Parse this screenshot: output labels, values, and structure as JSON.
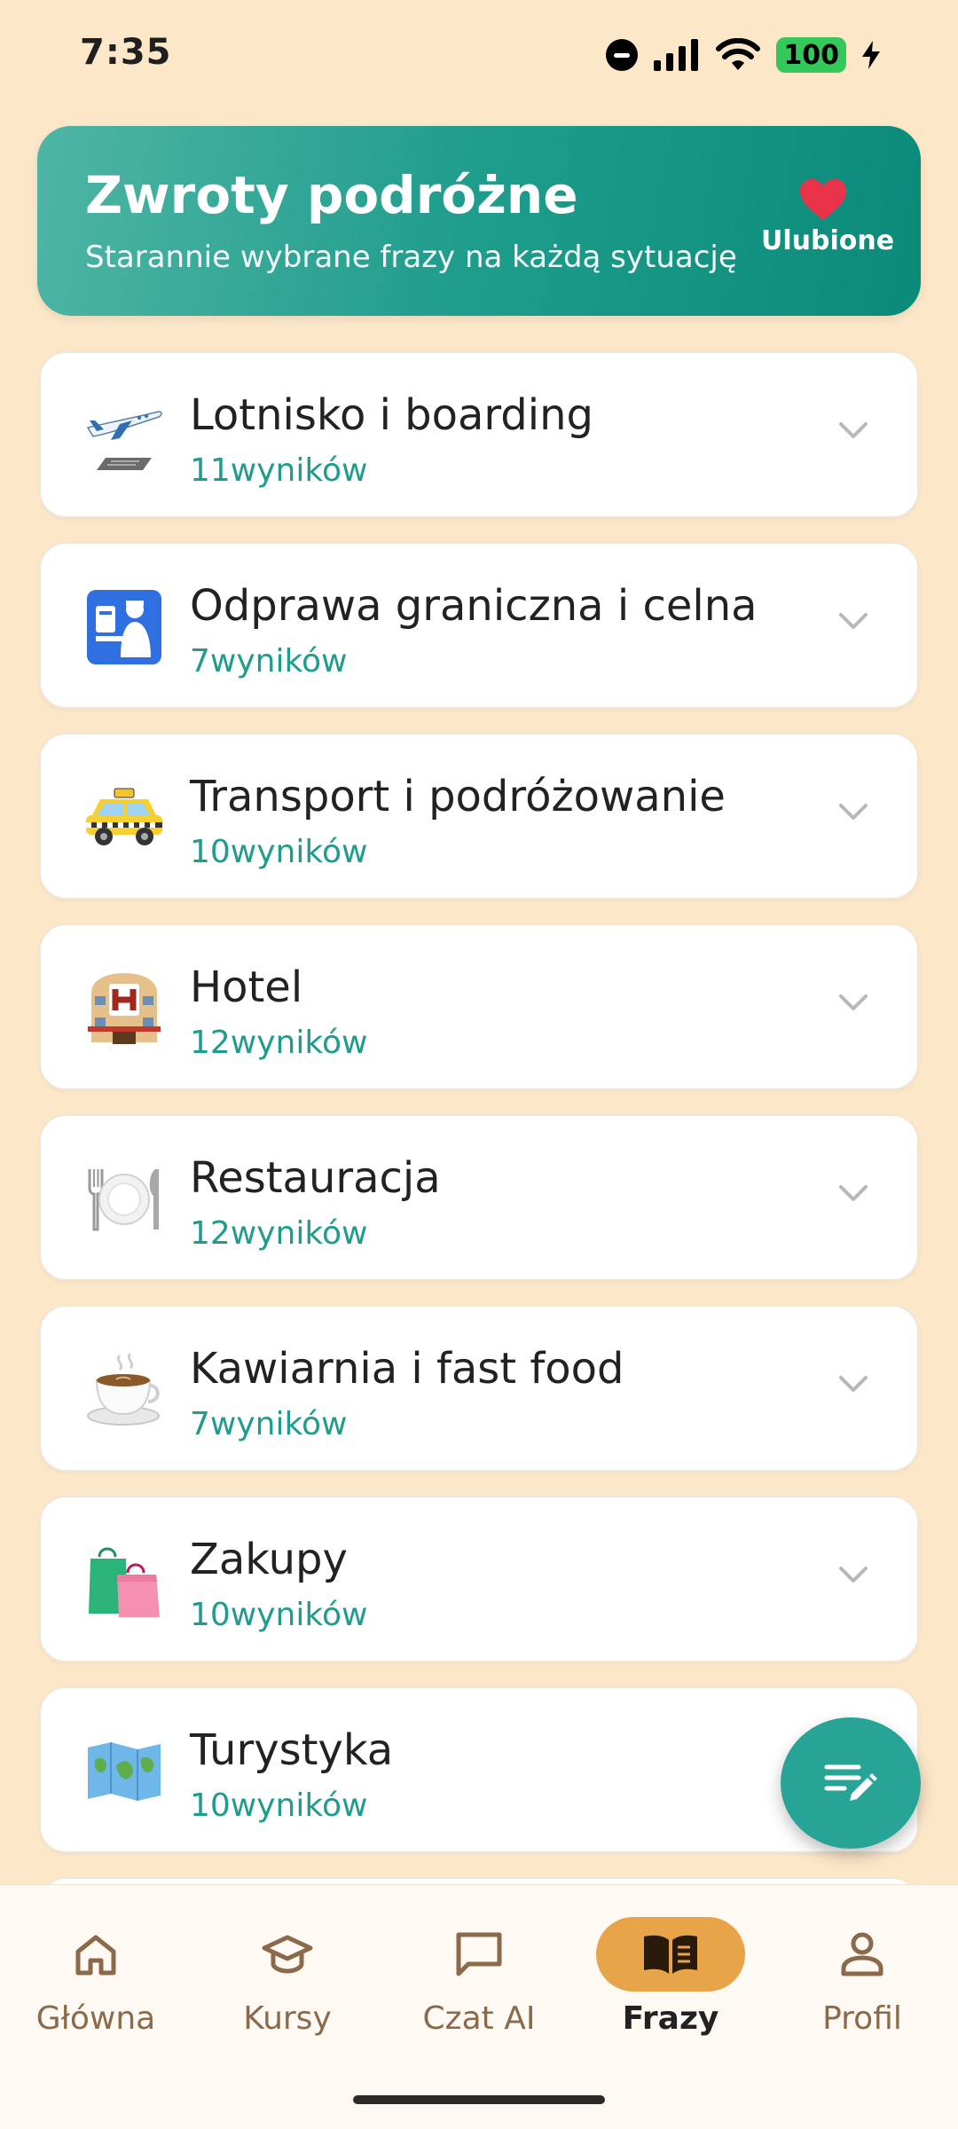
{
  "status": {
    "time": "7:35",
    "battery": "100"
  },
  "header": {
    "title": "Zwroty podróżne",
    "subtitle": "Starannie wybrane frazy na każdą sytuację",
    "favorites_label": "Ulubione"
  },
  "categories": [
    {
      "name": "Lotnisko i boarding",
      "count": "11wyników",
      "icon": "airplane-icon"
    },
    {
      "name": "Odprawa graniczna i celna",
      "count": "7wyników",
      "icon": "passport-control-icon"
    },
    {
      "name": "Transport i podróżowanie",
      "count": "10wyników",
      "icon": "taxi-icon"
    },
    {
      "name": "Hotel",
      "count": "12wyników",
      "icon": "hotel-icon"
    },
    {
      "name": "Restauracja",
      "count": "12wyników",
      "icon": "plate-cutlery-icon"
    },
    {
      "name": "Kawiarnia i fast food",
      "count": "7wyników",
      "icon": "coffee-icon"
    },
    {
      "name": "Zakupy",
      "count": "10wyników",
      "icon": "shopping-bags-icon"
    },
    {
      "name": "Turystyka",
      "count": "10wyników",
      "icon": "map-icon"
    }
  ],
  "nav": [
    {
      "label": "Główna",
      "icon": "home-icon",
      "active": false
    },
    {
      "label": "Kursy",
      "icon": "graduation-cap-icon",
      "active": false
    },
    {
      "label": "Czat AI",
      "icon": "chat-bubble-icon",
      "active": false
    },
    {
      "label": "Frazy",
      "icon": "book-icon",
      "active": true
    },
    {
      "label": "Profil",
      "icon": "person-icon",
      "active": false
    }
  ],
  "colors": {
    "background": "#FCE7C9",
    "header_gradient_start": "#4FB5A5",
    "header_gradient_end": "#0B8A7A",
    "accent": "#1E9C8C",
    "nav_active": "#E8A449",
    "heart": "#E8334A"
  }
}
